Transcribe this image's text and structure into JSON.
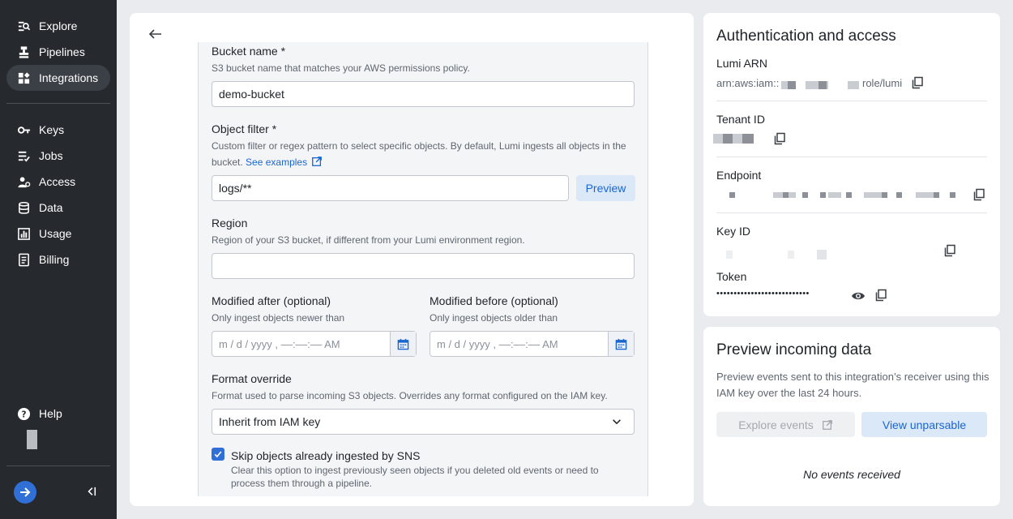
{
  "sidebar": {
    "items": [
      {
        "label": "Explore",
        "icon": "explore-icon"
      },
      {
        "label": "Pipelines",
        "icon": "pipelines-icon"
      },
      {
        "label": "Integrations",
        "icon": "integrations-icon",
        "active": true
      },
      {
        "label": "Keys",
        "icon": "key-icon"
      },
      {
        "label": "Jobs",
        "icon": "jobs-icon"
      },
      {
        "label": "Access",
        "icon": "access-icon"
      },
      {
        "label": "Data",
        "icon": "database-icon"
      },
      {
        "label": "Usage",
        "icon": "chart-icon"
      },
      {
        "label": "Billing",
        "icon": "billing-icon"
      }
    ],
    "help_label": "Help"
  },
  "form": {
    "bucket_name": {
      "label": "Bucket name *",
      "help": "S3 bucket name that matches your AWS permissions policy.",
      "value": "demo-bucket"
    },
    "object_filter": {
      "label": "Object filter *",
      "help": "Custom filter or regex pattern to select specific objects. By default, Lumi ingests all objects in the bucket.",
      "link": "See examples",
      "value": "logs/**",
      "preview_label": "Preview"
    },
    "region": {
      "label": "Region",
      "help": "Region of your S3 bucket, if different from your Lumi environment region.",
      "value": ""
    },
    "modified_after": {
      "label": "Modified after (optional)",
      "help": "Only ingest objects newer than",
      "placeholder": "m / d / yyyy ,  ––:––:–– AM"
    },
    "modified_before": {
      "label": "Modified before (optional)",
      "help": "Only ingest objects older than",
      "placeholder": "m / d / yyyy ,  ––:––:–– AM"
    },
    "format_override": {
      "label": "Format override",
      "help": "Format used to parse incoming S3 objects. Overrides any format configured on the IAM key.",
      "value": "Inherit from IAM key"
    },
    "skip_sns": {
      "label": "Skip objects already ingested by SNS",
      "help": "Clear this option to ingest previously seen objects if you deleted old events or need to process them through a pipeline.",
      "checked": true
    }
  },
  "auth": {
    "title": "Authentication and access",
    "arn_label": "Lumi ARN",
    "arn_prefix": "arn:aws:iam::",
    "arn_suffix": "role/lumi",
    "tenant_label": "Tenant ID",
    "endpoint_label": "Endpoint",
    "key_id_label": "Key ID",
    "token_label": "Token",
    "token_masked": "•••••••••••••••••••••••••••"
  },
  "preview": {
    "title": "Preview incoming data",
    "description": "Preview events sent to this integration’s receiver using this IAM key over the last 24 hours.",
    "explore_label": "Explore events",
    "unparsable_label": "View unparsable",
    "empty": "No events received"
  },
  "colors": {
    "sidebar_bg": "#262a2f",
    "accent": "#1a66d1",
    "page_bg": "#e9ebee"
  }
}
